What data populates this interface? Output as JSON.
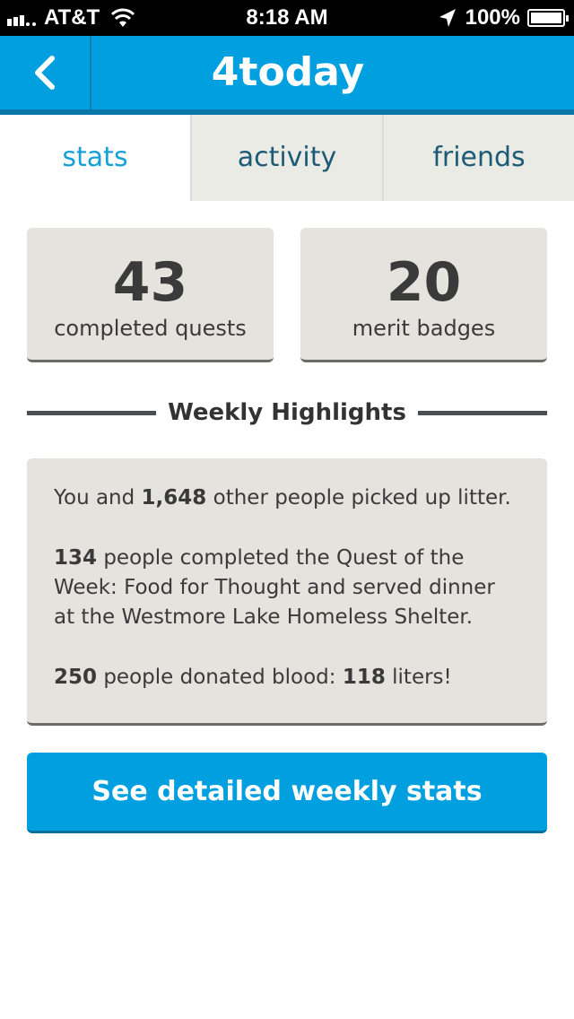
{
  "status_bar": {
    "carrier": "AT&T",
    "time": "8:18 AM",
    "battery_percent": "100%",
    "signal_icon": "signal-bars-icon",
    "wifi_icon": "wifi-icon",
    "location_icon": "location-arrow-icon",
    "battery_icon": "battery-icon",
    "battery_level": 1.0
  },
  "nav": {
    "title": "4today",
    "back_icon": "chevron-left-icon",
    "color": "#009fdf"
  },
  "tabs": [
    {
      "label": "stats",
      "active": true
    },
    {
      "label": "activity",
      "active": false
    },
    {
      "label": "friends",
      "active": false
    }
  ],
  "stats": [
    {
      "number": "43",
      "label": "completed quests"
    },
    {
      "number": "20",
      "label": "merit badges"
    }
  ],
  "highlights": {
    "title": "Weekly Highlights",
    "items": [
      {
        "pre": "You and ",
        "bold": "1,648",
        "post": " other people picked up litter."
      },
      {
        "bold": "134",
        "post": " people completed the Quest of the Week: Food for Thought and served dinner at the Westmore Lake Homeless Shelter."
      },
      {
        "bold": "250",
        "post": " people donated blood: ",
        "bold2": "118",
        "post2": " liters!"
      }
    ]
  },
  "cta": {
    "label": "See detailed weekly stats"
  },
  "colors": {
    "accent": "#009fdf",
    "card": "#e4e3de",
    "tab_inactive": "#ebebe6"
  }
}
